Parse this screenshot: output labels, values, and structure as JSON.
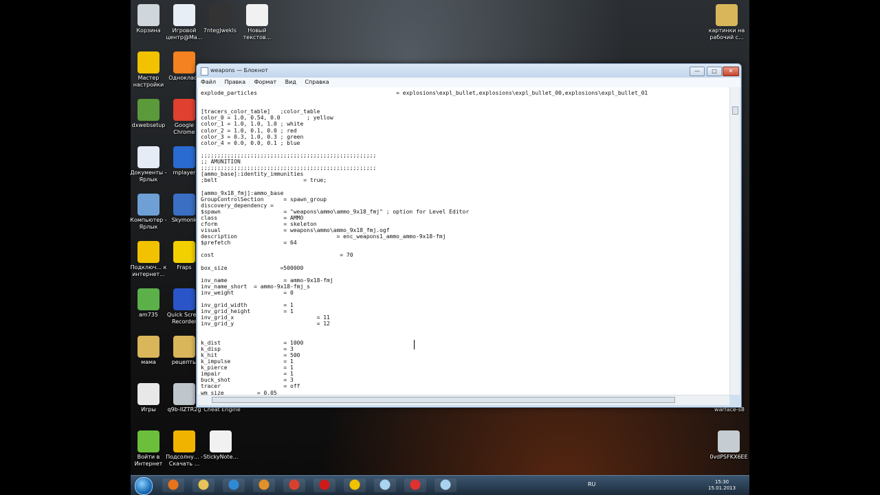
{
  "desktop_icons": [
    {
      "label": "Корзина",
      "icon": "recycle-bin-icon",
      "color": "#cfd6dc"
    },
    {
      "label": "Игровой центр@Ма...",
      "icon": "game-center-icon",
      "color": "#e8eef6"
    },
    {
      "label": "7ntegJwekls",
      "icon": "file-icon",
      "color": "#333"
    },
    {
      "label": "Новый текстов...",
      "icon": "text-file-icon",
      "color": "#f1f1f1"
    },
    {
      "label": "картинки на рабочий с...",
      "icon": "folder-icon",
      "color": "#d9b65a"
    },
    {
      "label": "Мастер настройки",
      "icon": "beeline-icon",
      "color": "#f2c200"
    },
    {
      "label": "Однокласс",
      "icon": "odnoklassniki-icon",
      "color": "#f58220"
    },
    {
      "label": "dxwebsetup",
      "icon": "directx-icon",
      "color": "#5a9a3a"
    },
    {
      "label": "Google Chrome",
      "icon": "chrome-icon",
      "color": "#e0402f"
    },
    {
      "label": "Документы - Ярлык",
      "icon": "documents-icon",
      "color": "#e6ecf5"
    },
    {
      "label": "mplayer",
      "icon": "media-player-icon",
      "color": "#2a6bd1"
    },
    {
      "label": "Компьютер - Ярлык",
      "icon": "computer-icon",
      "color": "#6ea0d6"
    },
    {
      "label": "Skymonk",
      "icon": "skymonk-icon",
      "color": "#3a6fc4"
    },
    {
      "label": "Подключ... к интернет...",
      "icon": "beeline-icon",
      "color": "#f2c200"
    },
    {
      "label": "Fraps",
      "icon": "fraps-icon",
      "color": "#f2d000"
    },
    {
      "label": "am735",
      "icon": "money-icon",
      "color": "#5bb04a"
    },
    {
      "label": "Quick Scre... Recorder",
      "icon": "screen-recorder-icon",
      "color": "#2a55c9"
    },
    {
      "label": "мама",
      "icon": "folder-icon",
      "color": "#d9b65a"
    },
    {
      "label": "рецепты",
      "icon": "folder-icon",
      "color": "#d9b65a"
    },
    {
      "label": "Игры",
      "icon": "games-icon",
      "color": "#e8e8e8"
    },
    {
      "label": "q9b-IlZTR2g",
      "icon": "image-icon",
      "color": "#bfc6cc"
    },
    {
      "label": "Cheat Engine",
      "icon": "cheat-engine-icon",
      "color": "#5a7ab0"
    },
    {
      "label": "warface-s8",
      "icon": "game-icon",
      "color": "#555"
    },
    {
      "label": "Войти в Интернет",
      "icon": "internet-icon",
      "color": "#6bbf3a"
    },
    {
      "label": "Подсолну... - Скачать ...",
      "icon": "sunflower-icon",
      "color": "#f0b400"
    },
    {
      "label": "StickyNote...",
      "icon": "sticky-note-icon",
      "color": "#f1f1f1"
    },
    {
      "label": "0vdPSFKX6EE",
      "icon": "image-icon",
      "color": "#c5ccd2"
    }
  ],
  "notepad": {
    "title": "weapons — Блокнот",
    "menu": [
      "Файл",
      "Правка",
      "Формат",
      "Вид",
      "Справка"
    ],
    "buttons": {
      "minimize": "—",
      "maximize": "□",
      "close": "✕"
    },
    "lines": [
      "explode_particles                                          = explosions\\expl_bullet,explosions\\expl_bullet_00,explosions\\expl_bullet_01",
      "",
      "",
      "[tracers_color_table]   ;color_table",
      "color_0 = 1.0, 0.54, 0.0        ; yellow",
      "color_1 = 1.0, 1.0, 1.0 ; white",
      "color_2 = 1.0, 0.1, 0.0 ; red",
      "color_3 = 0.3, 1.0, 0.3 ; green",
      "color_4 = 0.0, 0.0, 0.1 ; blue",
      "",
      ";;;;;;;;;;;;;;;;;;;;;;;;;;;;;;;;;;;;;;;;;;;;;;;;;;;;;",
      ";; AMUNITION",
      ";;;;;;;;;;;;;;;;;;;;;;;;;;;;;;;;;;;;;;;;;;;;;;;;;;;;;",
      "[ammo_base]:identity_immunities",
      ";belt                          = true;",
      "",
      "[ammo_9x18_fmj]:ammo_base",
      "GroupControlSection      = spawn_group",
      "discovery_dependency =",
      "$spawn                   = \"weapons\\ammo\\ammo_9x18_fmj\" ; option for Level Editor",
      "class                    = AMMO",
      "cform                    = skeleton",
      "visual                   = weapons\\ammo\\ammo_9x18_fmj.ogf",
      "description                              = enc_weapons1_ammo_ammo-9x18-fmj",
      "$prefetch                = 64",
      "",
      "cost                                      = 70",
      "",
      "box_size                =500000",
      "",
      "inv_name                 = ammo-9x18-fmj",
      "inv_name_short  = ammo-9x18-fmj_s",
      "inv_weight               = 0",
      "",
      "inv_grid_width           = 1",
      "inv_grid_height          = 1",
      "inv_grid_x                         = 11",
      "inv_grid_y                         = 12",
      "",
      "",
      "k_dist                   = 1000",
      "k_disp                   = 3",
      "k_hit                    = 500",
      "k_impulse                = 1",
      "k_pierce                 = 1",
      "impair                   = 1",
      "buck_shot                = 3",
      "tracer                   = off",
      "wm_size          = 0.05"
    ]
  },
  "taskbar": {
    "apps": [
      {
        "name": "firefox-icon",
        "color": "#e8731d"
      },
      {
        "name": "explorer-icon",
        "color": "#e8c35a"
      },
      {
        "name": "ie-icon",
        "color": "#2f8ad6"
      },
      {
        "name": "media-icon",
        "color": "#e0922a"
      },
      {
        "name": "chrome-icon",
        "color": "#d9412e"
      },
      {
        "name": "opera-icon",
        "color": "#cf1a1a"
      },
      {
        "name": "beeline-icon",
        "color": "#f2c200"
      },
      {
        "name": "notepad-icon",
        "color": "#a9d4f0"
      },
      {
        "name": "recorder-icon",
        "color": "#e03030"
      },
      {
        "name": "notepad2-icon",
        "color": "#a9d4f0"
      }
    ],
    "lang": "RU",
    "time": "15:30",
    "date": "15.01.2013"
  }
}
